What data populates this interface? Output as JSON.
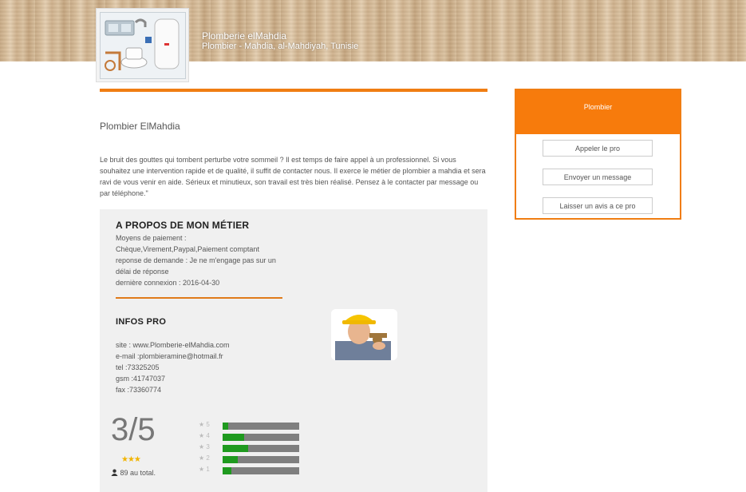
{
  "header": {
    "business_name": "Plomberie elMahdia",
    "subtitle": "Plombier - Mahdia, al-Mahdiyah, Tunisie"
  },
  "main": {
    "title": "Plombier ElMahdia",
    "description": "Le bruit des gouttes qui tombent perturbe votre sommeil ? Il est temps de faire appel à un professionnel. Si vous souhaitez une intervention rapide et de qualité, il suffit de contacter nous. Il exerce le métier de plombier a mahdia et sera ravi de vous venir en aide. Sérieux et minutieux, son travail est très bien réalisé. Pensez à le contacter par message ou par téléphone.\""
  },
  "about": {
    "title": "A PROPOS DE MON MÉTIER",
    "lines": [
      "Moyens de paiement :",
      "Chèque,Virement,Paypal,Paiement comptant",
      "reponse de demande : Je ne m'engage pas sur un",
      "délai de réponse",
      "dernière connexion : 2016-04-30"
    ]
  },
  "infos": {
    "title": "INFOS PRO",
    "site": "site : www.Plomberie-elMahdia.com",
    "email": "e-mail :plombieramine@hotmail.fr",
    "tel": "tel :73325205",
    "gsm": "gsm :41747037",
    "fax": "fax :73360774"
  },
  "rating": {
    "score": "3/5",
    "stars": "★★★",
    "total": "89 au total.",
    "distribution": [
      {
        "label": "5",
        "fraction": 0.07
      },
      {
        "label": "4",
        "fraction": 0.28
      },
      {
        "label": "3",
        "fraction": 0.33
      },
      {
        "label": "2",
        "fraction": 0.2
      },
      {
        "label": "1",
        "fraction": 0.11
      }
    ]
  },
  "sidebar": {
    "heading": "Plombier",
    "buttons": [
      {
        "label": "Appeler le pro"
      },
      {
        "label": "Envoyer un message"
      },
      {
        "label": "Laisser un avis a ce pro"
      }
    ]
  },
  "colors": {
    "accent": "#f77b0c",
    "bar_fill": "#1f9a1f",
    "bar_track": "#7f7f7f"
  }
}
